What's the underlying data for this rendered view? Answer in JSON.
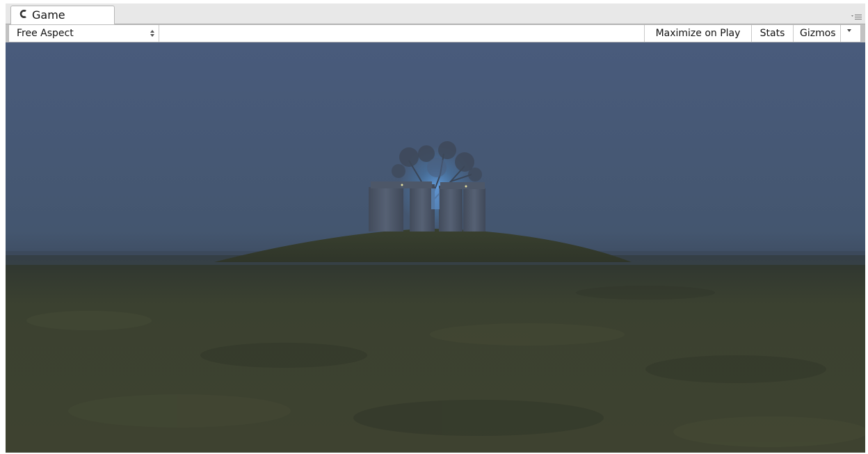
{
  "window": {
    "tab": {
      "icon": "unity-game-icon",
      "label": "Game"
    },
    "menu_icon": "panel-menu-icon"
  },
  "toolbar": {
    "aspect": {
      "selected": "Free Aspect",
      "icon": "up-down-arrows-icon"
    },
    "maximize_label": "Maximize on Play",
    "stats_label": "Stats",
    "gizmos_label": "Gizmos",
    "gizmos_dropdown_icon": "dropdown-triangle-icon"
  },
  "viewport": {
    "scene": "night landscape with grassy hill, ring of standing stones and a glowing tree",
    "colors": {
      "sky": "#47597a",
      "horizon_fog": "#3c4a5e",
      "grass": "#3a3f2c",
      "stone": "#4f5a6d",
      "tree_glow": "#4a8fd0"
    }
  }
}
